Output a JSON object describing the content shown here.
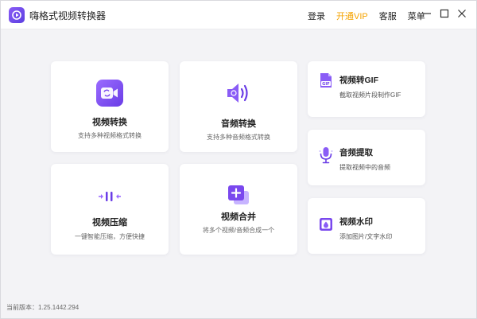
{
  "app": {
    "title": "嗨格式视频转换器"
  },
  "title_bar": {
    "links": {
      "login": "登录",
      "vip": "开通VIP",
      "service": "客服",
      "menu": "菜单"
    }
  },
  "colors": {
    "brand": "#7b4fe8",
    "vip": "#f5a300",
    "background": "#f3f3f6"
  },
  "features": {
    "video_convert": {
      "title": "视频转换",
      "desc": "支持多种视频格式转换",
      "icon": "video-convert-icon"
    },
    "audio_convert": {
      "title": "音频转换",
      "desc": "支持多种音频格式转换",
      "icon": "audio-convert-icon"
    },
    "video_to_gif": {
      "title": "视频转GIF",
      "desc": "截取视频片段制作GIF",
      "icon": "gif-icon"
    },
    "audio_extract": {
      "title": "音频提取",
      "desc": "提取视频中的音频",
      "icon": "microphone-icon"
    },
    "video_compress": {
      "title": "视频压缩",
      "desc": "一键智能压缩，方便快捷",
      "icon": "compress-icon"
    },
    "video_merge": {
      "title": "视频合并",
      "desc": "将多个视频/音频合成一个",
      "icon": "merge-icon"
    },
    "watermark": {
      "title": "视频水印",
      "desc": "添加图片/文字水印",
      "icon": "watermark-icon"
    }
  },
  "footer": {
    "version": "当前版本：1.25.1442.294"
  }
}
